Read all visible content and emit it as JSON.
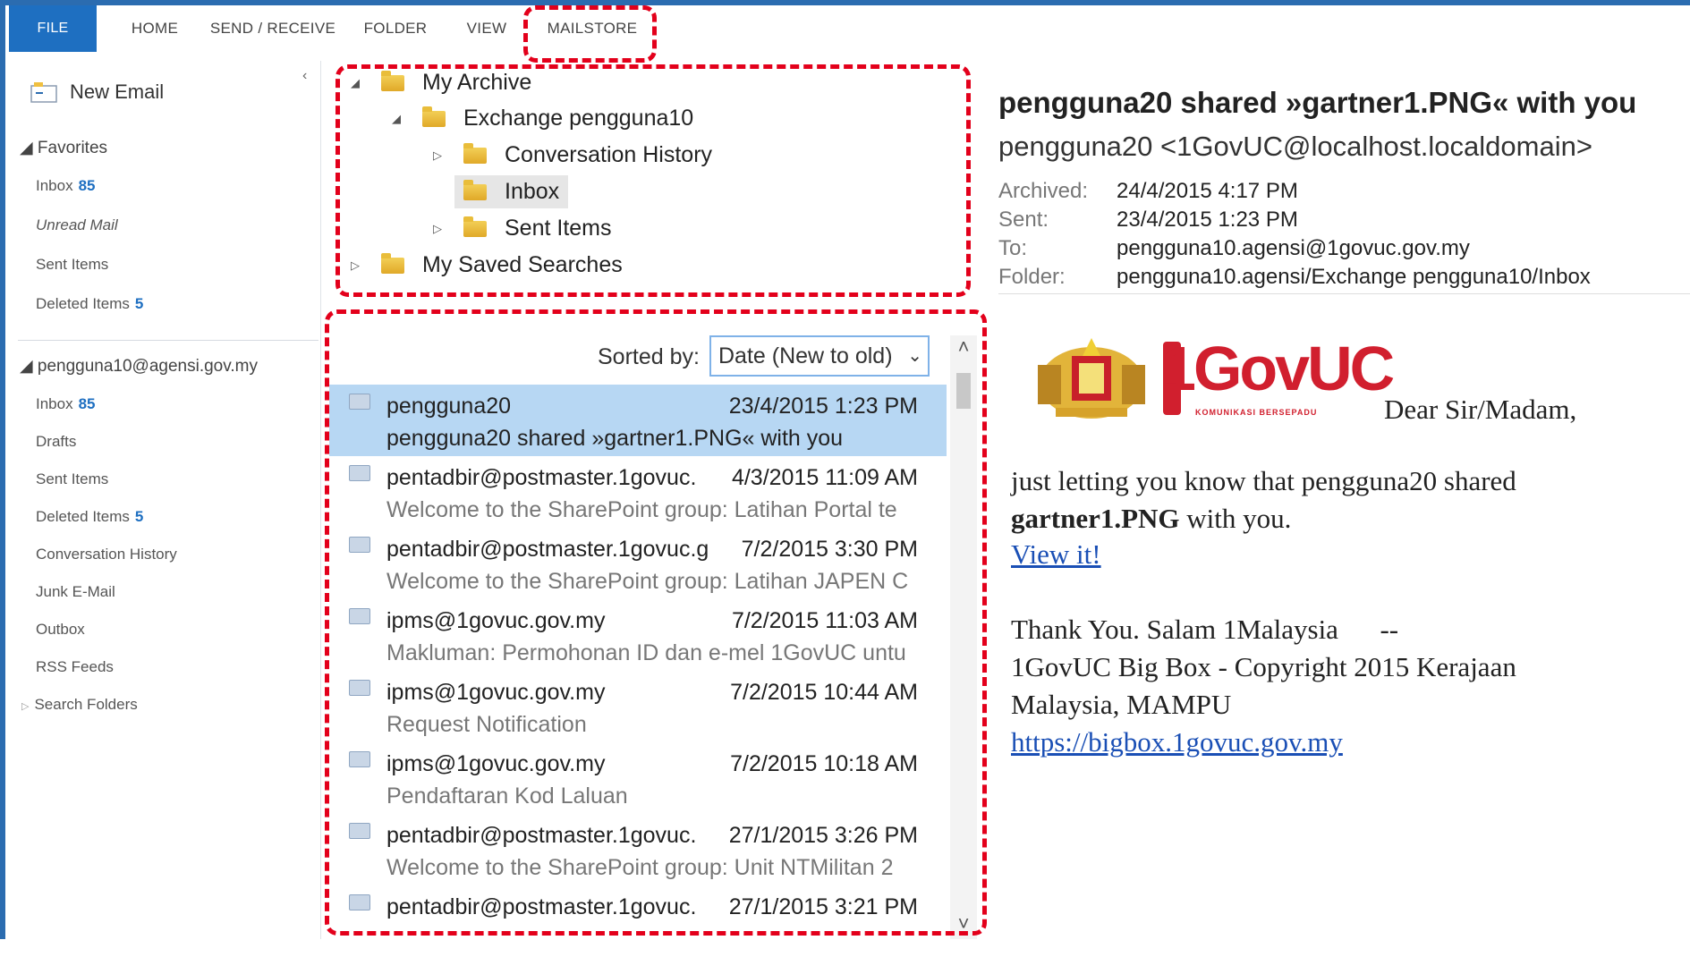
{
  "ribbon": {
    "tabs": [
      "FILE",
      "HOME",
      "SEND / RECEIVE",
      "FOLDER",
      "VIEW",
      "MAILSTORE"
    ]
  },
  "nav": {
    "new_email": "New Email",
    "favorites_header": "Favorites",
    "favorites": [
      {
        "label": "Inbox",
        "count": "85"
      },
      {
        "label": "Unread Mail",
        "count": ""
      },
      {
        "label": "Sent Items",
        "count": ""
      },
      {
        "label": "Deleted Items",
        "count": "5"
      }
    ],
    "account_header": "pengguna10@agensi.gov.my",
    "account_items": [
      {
        "label": "Inbox",
        "count": "85"
      },
      {
        "label": "Drafts",
        "count": ""
      },
      {
        "label": "Sent Items",
        "count": ""
      },
      {
        "label": "Deleted Items",
        "count": "5"
      },
      {
        "label": "Conversation History",
        "count": ""
      },
      {
        "label": "Junk E-Mail",
        "count": ""
      },
      {
        "label": "Outbox",
        "count": ""
      },
      {
        "label": "RSS Feeds",
        "count": ""
      },
      {
        "label": "Search Folders",
        "count": ""
      }
    ]
  },
  "archive_tree": {
    "root": "My Archive",
    "mailbox": "Exchange pengguna10",
    "folders": [
      "Conversation History",
      "Inbox",
      "Sent Items"
    ],
    "saved_searches": "My Saved Searches"
  },
  "list": {
    "sort_label": "Sorted by:",
    "sort_value": "Date (New to old)",
    "messages": [
      {
        "sender": "pengguna20",
        "date": "23/4/2015 1:23 PM",
        "subject": "pengguna20 shared »gartner1.PNG« with you"
      },
      {
        "sender": "pentadbir@postmaster.1govuc.",
        "date": "4/3/2015 11:09 AM",
        "subject": "Welcome to the SharePoint group: Latihan Portal te"
      },
      {
        "sender": "pentadbir@postmaster.1govuc.g",
        "date": "7/2/2015 3:30 PM",
        "subject": "Welcome to the SharePoint group: Latihan JAPEN C"
      },
      {
        "sender": "ipms@1govuc.gov.my",
        "date": "7/2/2015 11:03 AM",
        "subject": "Makluman: Permohonan ID dan e-mel 1GovUC untu"
      },
      {
        "sender": "ipms@1govuc.gov.my",
        "date": "7/2/2015 10:44 AM",
        "subject": "Request Notification"
      },
      {
        "sender": "ipms@1govuc.gov.my",
        "date": "7/2/2015 10:18 AM",
        "subject": "Pendaftaran Kod Laluan"
      },
      {
        "sender": "pentadbir@postmaster.1govuc.",
        "date": "27/1/2015 3:26 PM",
        "subject": "Welcome to the SharePoint group: Unit NTMilitan 2"
      },
      {
        "sender": "pentadbir@postmaster.1govuc.",
        "date": "27/1/2015 3:21 PM",
        "subject": ""
      }
    ]
  },
  "reading": {
    "subject": "pengguna20 shared »gartner1.PNG« with you",
    "from": "pengguna20 <1GovUC@localhost.localdomain>",
    "meta": [
      {
        "label": "Archived:",
        "value": "24/4/2015 4:17 PM"
      },
      {
        "label": "Sent:",
        "value": "23/4/2015 1:23 PM"
      },
      {
        "label": "To:",
        "value": "pengguna10.agensi@1govuc.gov.my"
      },
      {
        "label": "Folder:",
        "value": "pengguna10.agensi/Exchange pengguna10/Inbox"
      }
    ],
    "logo_text": "GovUC",
    "logo_digit": "1",
    "logo_tagline": "KOMUNIKASI BERSEPADU",
    "greeting": "Dear Sir/Madam,",
    "body_line1": "just letting you know that pengguna20 shared",
    "body_file": "gartner1.PNG",
    "body_with": " with you.",
    "view_link": "View it!",
    "thanks": "Thank You. Salam 1Malaysia      --",
    "footer_line1": "1GovUC Big Box - Copyright 2015 Kerajaan",
    "footer_line2": "Malaysia, MAMPU",
    "footer_url": "https://bigbox.1govuc.gov.my"
  },
  "colors": {
    "accent": "#1e6fc1",
    "highlight": "#e3001b",
    "selected_row": "#b7d7f3"
  }
}
